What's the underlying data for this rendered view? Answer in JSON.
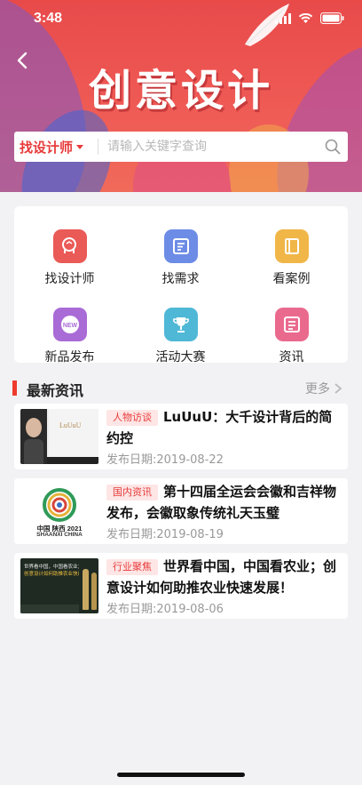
{
  "status": {
    "time": "3:48"
  },
  "banner": {
    "title": "创意设计"
  },
  "search": {
    "selector": "找设计师",
    "placeholder": "请输入关键字查询"
  },
  "grid": [
    {
      "label": "找设计师",
      "icon": "designer-icon",
      "color": "#ea5a57"
    },
    {
      "label": "找需求",
      "icon": "demand-icon",
      "color": "#6d8ce6"
    },
    {
      "label": "看案例",
      "icon": "case-book-icon",
      "color": "#f0b648"
    },
    {
      "label": "新品发布",
      "icon": "new-product-icon",
      "color": "#a96bd6"
    },
    {
      "label": "活动大赛",
      "icon": "trophy-icon",
      "color": "#4fb8d6"
    },
    {
      "label": "资讯",
      "icon": "news-icon",
      "color": "#ea6a8e"
    }
  ],
  "section": {
    "title": "最新资讯",
    "more": "更多"
  },
  "news": [
    {
      "tag": "人物访谈",
      "title": "LuUuU：大千设计背后的简约控",
      "date": "发布日期:2019-08-22",
      "thumb_text": "LuUuU"
    },
    {
      "tag": "国内资讯",
      "title": "第十四届全运会会徽和吉祥物发布，会徽取象传统礼天玉璧",
      "date": "发布日期:2019-08-19",
      "thumb_text": "中国 陕西 2021",
      "thumb_sub": "SHAANXI CHINA"
    },
    {
      "tag": "行业聚焦",
      "title": "世界看中国，中国看农业；创意设计如何助推农业快速发展！",
      "date": "发布日期:2019-08-06",
      "thumb_text": "世界看中国，中国看农业；",
      "thumb_sub": "创意设计如何助推农业快速发展！"
    }
  ]
}
